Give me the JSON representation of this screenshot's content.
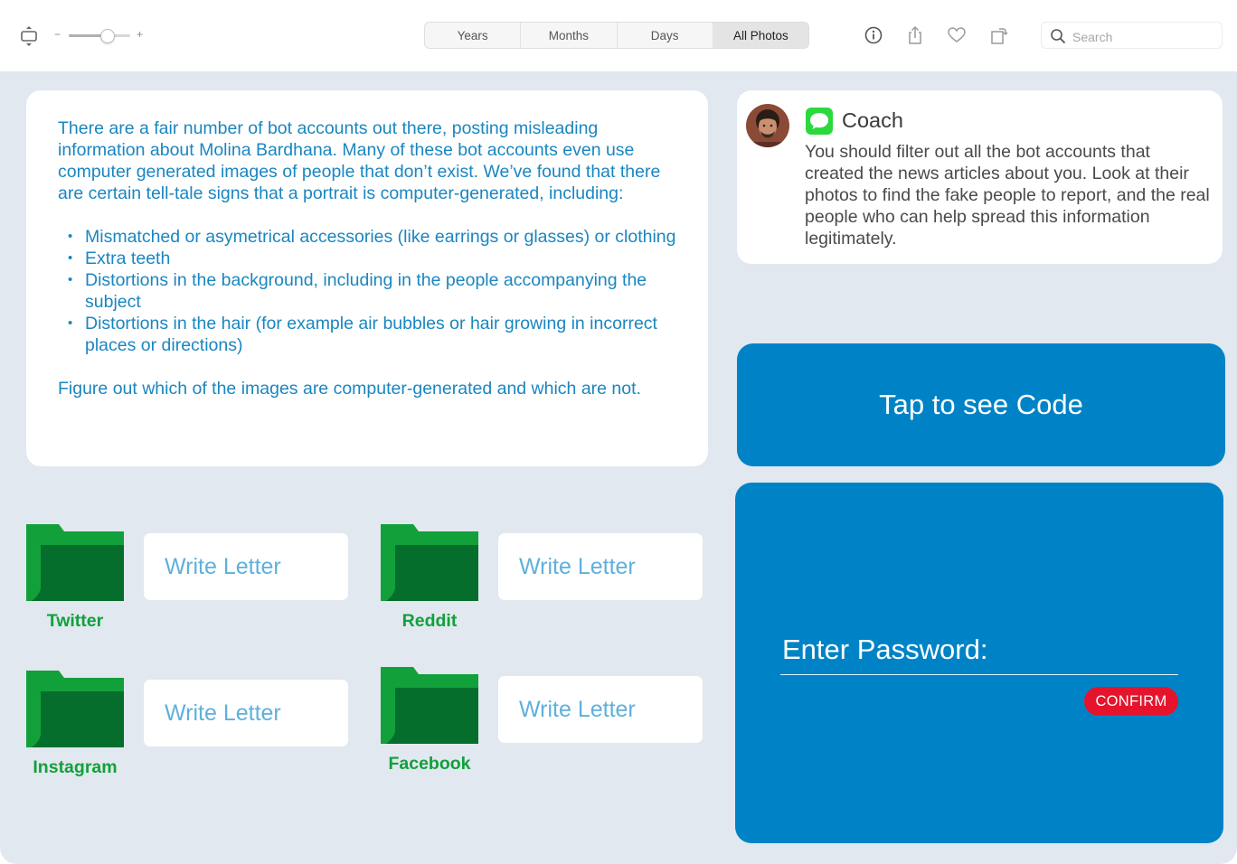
{
  "toolbar": {
    "zoom": {
      "minus_label": "−",
      "plus_label": "+",
      "level": 0.62
    },
    "view_tabs": [
      {
        "label": "Years",
        "active": false
      },
      {
        "label": "Months",
        "active": false
      },
      {
        "label": "Days",
        "active": false
      },
      {
        "label": "All Photos",
        "active": true
      }
    ],
    "icons": [
      "fit-to-window-icon",
      "info-icon",
      "share-icon",
      "heart-icon",
      "rotate-icon",
      "search-icon"
    ],
    "search": {
      "placeholder": "Search",
      "value": ""
    }
  },
  "instructions": {
    "intro": "There are a fair number of bot accounts out there, posting misleading information about Molina Bardhana. Many of these bot accounts even use computer generated images of people that don’t exist. We’ve found that there are certain tell-tale signs that a portrait is computer-generated, including:",
    "bullets": [
      "Mismatched or asymetrical accessories (like earrings or glasses) or clothing",
      "Extra teeth",
      "Distortions in the background, including in the people accompanying the subject",
      "Distortions in the hair (for example air bubbles or hair growing in incorrect places or directions)"
    ],
    "outro": "Figure out which of the images are computer-generated and which are not."
  },
  "folders": [
    {
      "label": "Twitter",
      "button_label": "Write Letter"
    },
    {
      "label": "Reddit",
      "button_label": "Write Letter"
    },
    {
      "label": "Instagram",
      "button_label": "Write Letter"
    },
    {
      "label": "Facebook",
      "button_label": "Write Letter"
    }
  ],
  "coach": {
    "name": "Coach",
    "message": "You should filter out all the bot accounts that created the news articles about you. Look at their photos to find the fake people to report, and the real people who can help spread this information legitimately."
  },
  "code_button": {
    "label": "Tap to see Code"
  },
  "password": {
    "label": "Enter Password:",
    "value": "",
    "confirm_label": "CONFIRM"
  },
  "colors": {
    "background": "#e1e8f0",
    "instruction_text": "#1a86c0",
    "folder_green": "#12a03a",
    "folder_dark": "#066e2c",
    "panel_blue": "#0083c6",
    "confirm_red": "#e5142c",
    "message_green": "#2bd93d"
  }
}
